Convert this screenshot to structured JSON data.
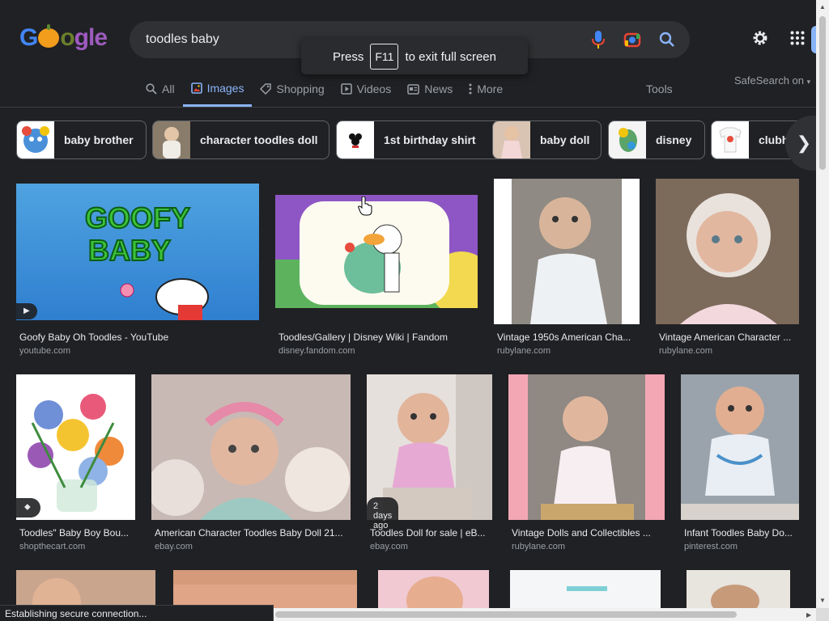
{
  "search": {
    "query": "toodles baby"
  },
  "toast": {
    "press": "Press",
    "key": "F11",
    "rest": "to exit full screen"
  },
  "tabs": [
    {
      "label": "All",
      "icon": "search-icon"
    },
    {
      "label": "Images",
      "icon": "image-icon",
      "active": true
    },
    {
      "label": "Shopping",
      "icon": "tag-icon"
    },
    {
      "label": "Videos",
      "icon": "play-icon"
    },
    {
      "label": "News",
      "icon": "news-icon"
    },
    {
      "label": "More",
      "icon": "more-vertical-icon"
    }
  ],
  "tools_label": "Tools",
  "safesearch_label": "SafeSearch on",
  "chips": [
    {
      "label": "baby brother",
      "color": "#e74c3c"
    },
    {
      "label": "character toodles doll",
      "color": "#b9a78e"
    },
    {
      "label": "1st birthday shirt",
      "color": "#ffffff"
    },
    {
      "label": "baby doll",
      "color": "#c9a48a"
    },
    {
      "label": "disney",
      "color": "#e8e8e8"
    },
    {
      "label": "clubh",
      "color": "#f5f5f5"
    }
  ],
  "results": [
    {
      "title": "Goofy Baby Oh Toodles - YouTube",
      "site": "youtube.com"
    },
    {
      "title": "Toodles/Gallery | Disney Wiki | Fandom",
      "site": "disney.fandom.com"
    },
    {
      "title": "Vintage 1950s American Cha...",
      "site": "rubylane.com"
    },
    {
      "title": "Vintage American Character ...",
      "site": "rubylane.com"
    },
    {
      "title": "Toodles\" Baby Boy Bou...",
      "site": "shopthecart.com"
    },
    {
      "title": "American Character Toodles Baby Doll 21...",
      "site": "ebay.com"
    },
    {
      "title": "Toodles Doll for sale | eB...",
      "site": "ebay.com",
      "badge": "2 days ago"
    },
    {
      "title": "Vintage Dolls and Collectibles ...",
      "site": "rubylane.com"
    },
    {
      "title": "Infant Toodles Baby Do...",
      "site": "pinterest.com"
    }
  ],
  "goofy_text": [
    "GOOFY",
    "BABY"
  ],
  "status_text": "Establishing secure connection..."
}
